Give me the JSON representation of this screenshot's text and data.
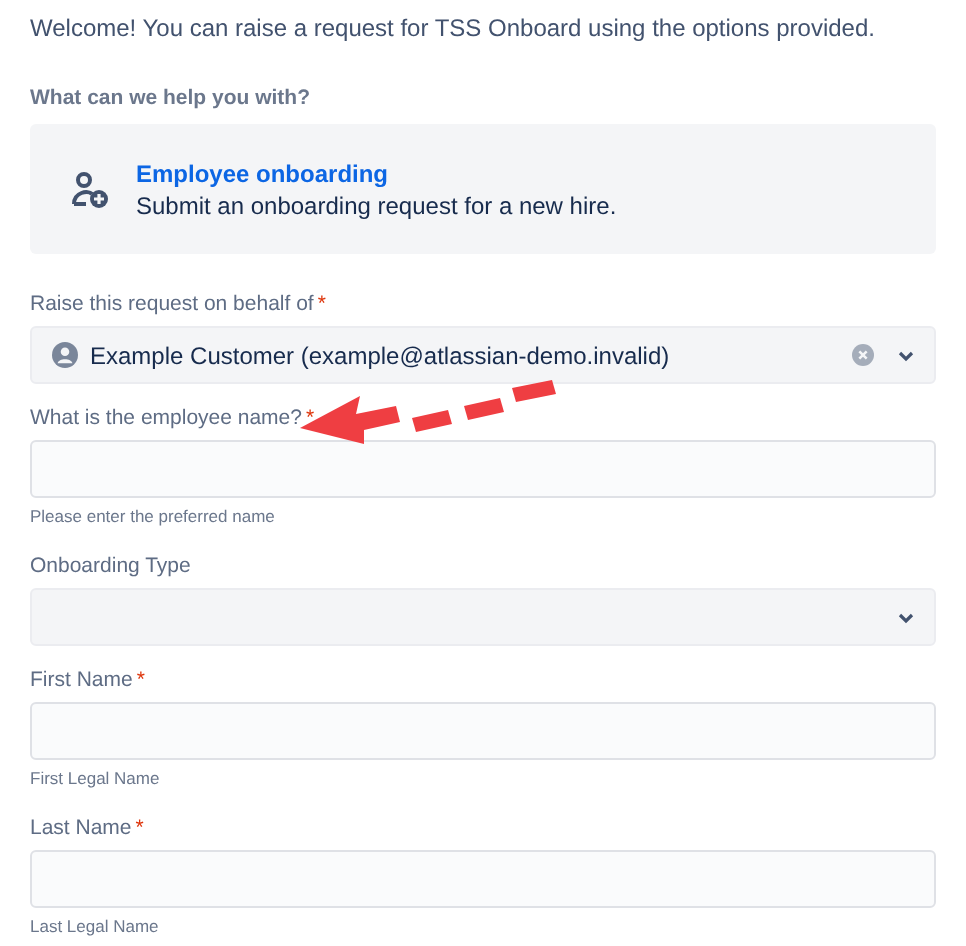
{
  "intro": "Welcome! You can raise a request for TSS Onboard using the options provided.",
  "request_type": {
    "label": "What can we help you with?",
    "title": "Employee onboarding",
    "description": "Submit an onboarding request for a new hire."
  },
  "fields": [
    {
      "kind": "select",
      "label": "Raise this request on behalf of",
      "required_mark": "*",
      "value": "Example Customer (example@atlassian-demo.invalid)",
      "clearable": true
    },
    {
      "kind": "text",
      "label": "What is the employee name?",
      "required_mark": "*",
      "helper": "Please enter the preferred name"
    },
    {
      "kind": "select",
      "label": "Onboarding Type"
    },
    {
      "kind": "text",
      "label": "First Name",
      "required_mark": "*",
      "helper": "First Legal Name"
    },
    {
      "kind": "text",
      "label": "Last Name",
      "required_mark": "*",
      "helper": "Last Legal Name"
    }
  ]
}
